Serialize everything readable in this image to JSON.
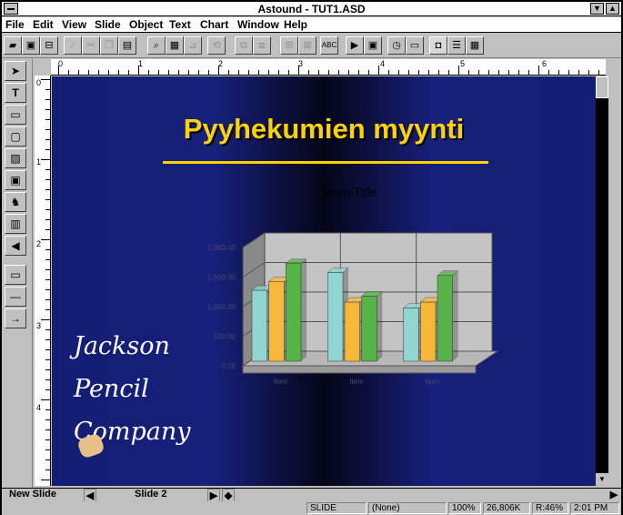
{
  "window": {
    "title": "Astound - TUT1.ASD"
  },
  "menu": [
    "File",
    "Edit",
    "View",
    "Slide",
    "Object",
    "Text",
    "Chart",
    "Window",
    "Help"
  ],
  "slide": {
    "title": "Pyyhekumien myynti",
    "chart_title": "Main Title",
    "company_line1": "Jackson",
    "company_line2": "Pencil",
    "company_line3": "Company"
  },
  "chart_data": {
    "type": "bar",
    "title": "Main Title",
    "categories": [
      "Item",
      "Item",
      "Item"
    ],
    "y_tick_labels": [
      "0.00",
      "500.00",
      "1,000.00",
      "1,500.00",
      "2,000.00"
    ],
    "ylim": [
      0,
      2000
    ],
    "series": [
      {
        "values": [
          1200,
          1500,
          900
        ],
        "color": "#8fd6d3"
      },
      {
        "values": [
          1350,
          1000,
          1000
        ],
        "color": "#f7b83a"
      },
      {
        "values": [
          1650,
          1100,
          1450
        ],
        "color": "#55b347"
      }
    ]
  },
  "ruler": {
    "h": [
      "0",
      "1",
      "2",
      "3",
      "4",
      "5",
      "6"
    ],
    "v": [
      "0",
      "1",
      "2",
      "3",
      "4"
    ]
  },
  "tabbar": {
    "new_slide": "New Slide",
    "slide_name": "Slide 2"
  },
  "status": {
    "mode": "SLIDE",
    "none": "(None)",
    "zoom": "100%",
    "memory": "26,806K",
    "ratio": "R:46%",
    "time": "2:01 PM"
  }
}
